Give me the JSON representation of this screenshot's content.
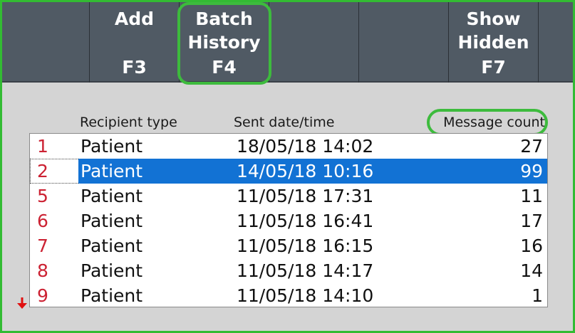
{
  "toolbar": {
    "buttons": [
      {
        "id": "add",
        "label_lines": [
          "Add"
        ],
        "key": "F3"
      },
      {
        "id": "batch-history",
        "label_lines": [
          "Batch",
          "History"
        ],
        "key": "F4"
      },
      {
        "id": "blank-1",
        "label_lines": [],
        "key": ""
      },
      {
        "id": "blank-2",
        "label_lines": [],
        "key": ""
      },
      {
        "id": "show-hidden",
        "label_lines": [
          "Show",
          "Hidden"
        ],
        "key": "F7"
      }
    ]
  },
  "list": {
    "columns": [
      "Recipient type",
      "Sent date/time",
      "Message count"
    ],
    "rows": [
      {
        "num": "1",
        "type": "Patient",
        "sent": "18/05/18 14:02",
        "count": "27",
        "selected": false
      },
      {
        "num": "2",
        "type": "Patient",
        "sent": "14/05/18 10:16",
        "count": "99",
        "selected": true
      },
      {
        "num": "5",
        "type": "Patient",
        "sent": "11/05/18 17:31",
        "count": "11",
        "selected": false
      },
      {
        "num": "6",
        "type": "Patient",
        "sent": "11/05/18 16:41",
        "count": "17",
        "selected": false
      },
      {
        "num": "7",
        "type": "Patient",
        "sent": "11/05/18 16:15",
        "count": "16",
        "selected": false
      },
      {
        "num": "8",
        "type": "Patient",
        "sent": "11/05/18 14:17",
        "count": "14",
        "selected": false
      },
      {
        "num": "9",
        "type": "Patient",
        "sent": "11/05/18 14:10",
        "count": "1",
        "selected": false
      }
    ]
  },
  "colors": {
    "toolbar": "#505a64",
    "highlight": "#3dbb3d",
    "selection": "#1272d4",
    "row_number": "#cc2233"
  },
  "icons": {
    "scroll_down": "red-down-arrow-icon"
  }
}
